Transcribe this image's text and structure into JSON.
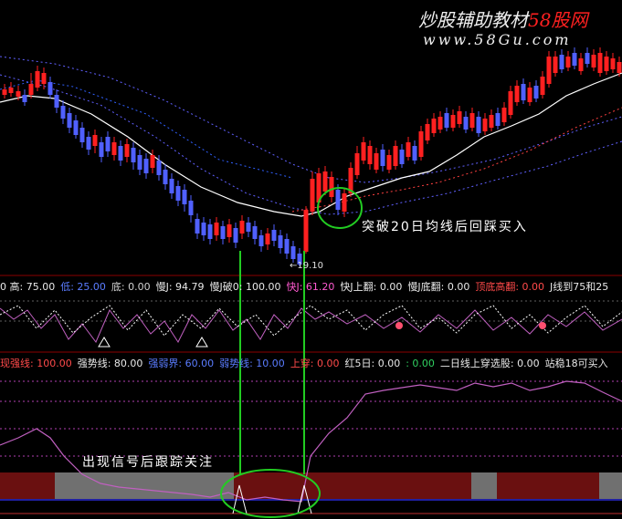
{
  "watermark": {
    "title_cn": "炒股辅助教材",
    "title_site": "58股网",
    "url": "www.58Gu.com"
  },
  "annotations": {
    "breakout": "突破20日均线后回踩买入",
    "signal": "出现信号后跟踪关注",
    "price_label": "←19.10"
  },
  "indicator1": {
    "items": [
      {
        "text": "0 高: 75.00",
        "color": "#e8e8e8"
      },
      {
        "text": "低: 25.00",
        "color": "#5a7cff"
      },
      {
        "text": "底: 0.00",
        "color": "#d0d0d0"
      },
      {
        "text": "慢J: 94.79",
        "color": "#e8e8e8"
      },
      {
        "text": "慢J破0: 100.00",
        "color": "#e8e8e8"
      },
      {
        "text": "快J: 61.20",
        "color": "#ff5ad0"
      },
      {
        "text": "快J上翻: 0.00",
        "color": "#e8e8e8"
      },
      {
        "text": "慢J底翻: 0.00",
        "color": "#e8e8e8"
      },
      {
        "text": "顶底高翻: 0.00",
        "color": "#ff4a4a"
      },
      {
        "text": "J线到75和25",
        "color": "#e8e8e8"
      }
    ]
  },
  "indicator2": {
    "items": [
      {
        "text": "现强线: 100.00",
        "color": "#ff4a4a"
      },
      {
        "text": "强势线: 80.00",
        "color": "#e8e8e8"
      },
      {
        "text": "强弱界: 60.00",
        "color": "#5a7cff"
      },
      {
        "text": "弱势线: 10.00",
        "color": "#5a7cff"
      },
      {
        "text": "上穿: 0.00",
        "color": "#ff4a4a"
      },
      {
        "text": "红5日: 0.00",
        "color": "#e8e8e8"
      },
      {
        "text": ": 0.00",
        "color": "#30d060"
      },
      {
        "text": "二日线上穿选股: 0.00",
        "color": "#e8e8e8"
      },
      {
        "text": "站稳18可买入",
        "color": "#e8e8e8"
      }
    ]
  },
  "colors": {
    "up": "#ff2020",
    "down": "#5060ff",
    "ma": "#ffffff",
    "highlight": "#22cc22",
    "kdj": "#c060c0",
    "panel_band": "#6a1010",
    "panel_gray": "#707070"
  }
}
